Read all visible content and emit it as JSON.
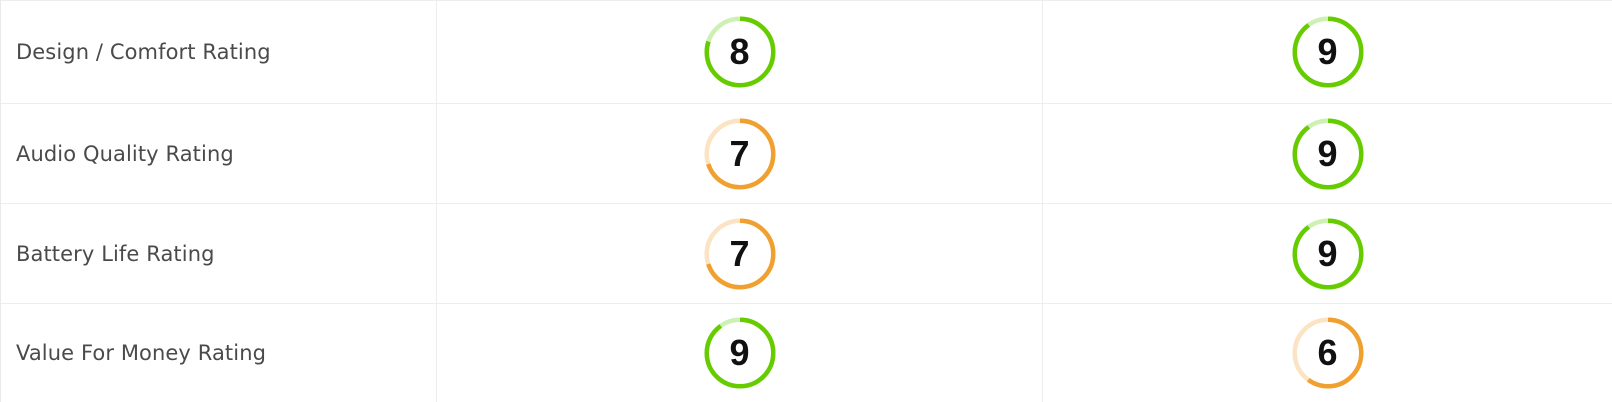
{
  "colors": {
    "high": "#66cc00",
    "high_track": "#cdf0b3",
    "mid": "#f0a030",
    "mid_track": "#fbe3c3"
  },
  "rows": [
    {
      "label": "Design / Comfort Rating",
      "scores": [
        8,
        9
      ]
    },
    {
      "label": "Audio Quality Rating",
      "scores": [
        7,
        9
      ]
    },
    {
      "label": "Battery Life Rating",
      "scores": [
        7,
        9
      ]
    },
    {
      "label": "Value For Money Rating",
      "scores": [
        9,
        6
      ]
    }
  ]
}
